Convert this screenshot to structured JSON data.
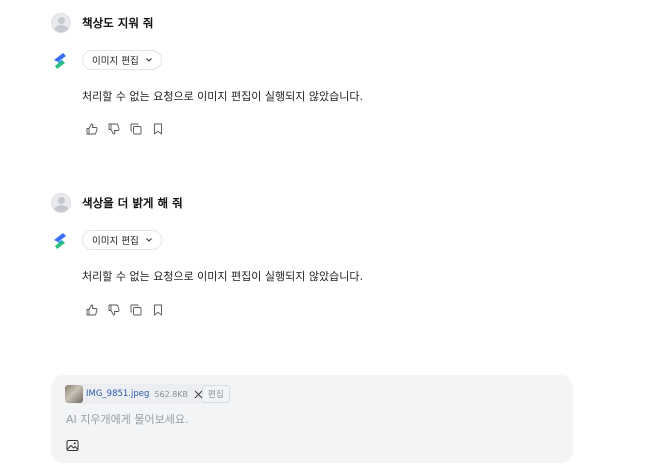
{
  "conversation": [
    {
      "user_message": "책상도 지워 줘",
      "tool_chip": "이미지 편집",
      "reply": "처리할 수 없는 요청으로 이미지 편집이 실행되지 않았습니다."
    },
    {
      "user_message": "색상을 더 밝게 해 줘",
      "tool_chip": "이미지 편집",
      "reply": "처리할 수 없는 요청으로 이미지 편집이 실행되지 않았습니다."
    }
  ],
  "composer": {
    "attachment": {
      "filename": "IMG_9851.jpeg",
      "size": "562.8KB"
    },
    "edit_label": "편집",
    "placeholder": "AI 지우개에게 물어보세요."
  },
  "icons": {
    "avatar": "user-avatar-icon",
    "logo": "assistant-logo-icon",
    "actions": [
      "thumbs-up-icon",
      "thumbs-down-icon",
      "copy-icon",
      "bookmark-icon"
    ],
    "image": "image-icon"
  },
  "colors": {
    "logo_blue": "#3b6cf6",
    "logo_green": "#2ec27e",
    "composer_bg": "#f3f4f6",
    "filename": "#2b5aa8"
  }
}
